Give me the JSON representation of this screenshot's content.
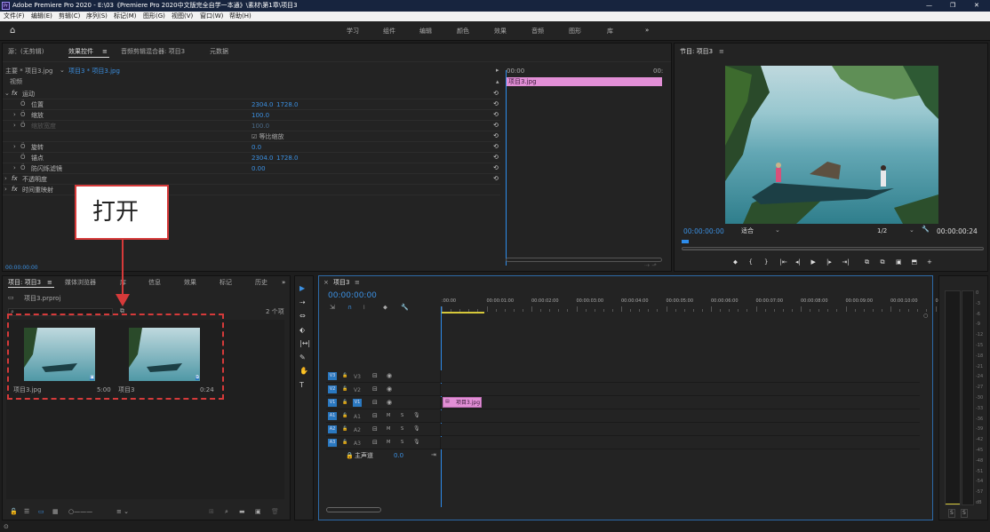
{
  "app": {
    "title": "Adobe Premiere Pro 2020 - E:\\03《Premiere Pro 2020中文版完全自学一本通》\\素材\\第1章\\项目3",
    "window_controls": [
      "—",
      "❐",
      "✕"
    ]
  },
  "menu": [
    "文件(F)",
    "编辑(E)",
    "剪辑(C)",
    "序列(S)",
    "标记(M)",
    "图形(G)",
    "视图(V)",
    "窗口(W)",
    "帮助(H)"
  ],
  "workspaces": [
    "学习",
    "组件",
    "编辑",
    "颜色",
    "效果",
    "音频",
    "图形",
    "库"
  ],
  "workspace_more": "»",
  "effects": {
    "tabs": [
      "源：(无剪辑)",
      "效果控件",
      "音频剪辑混合器: 项目3",
      "元数据"
    ],
    "menu_glyph": "≡",
    "master": "主要 * 项目3.jpg",
    "clip": "项目3 * 项目3.jpg",
    "section": "视频",
    "rows": [
      {
        "indent": 0,
        "exp": "⌄",
        "fx": "fx",
        "name": "运动",
        "v1": "",
        "v2": "",
        "reset": "⟲"
      },
      {
        "indent": 1,
        "exp": "",
        "fx": "Ö",
        "name": "位置",
        "v1": "2304.0",
        "v2": "1728.0",
        "reset": "⟲"
      },
      {
        "indent": 1,
        "exp": "›",
        "fx": "Ö",
        "name": "缩放",
        "v1": "100.0",
        "v2": "",
        "reset": "⟲"
      },
      {
        "indent": 1,
        "exp": "›",
        "fx": "Ö",
        "name": "缩放宽度",
        "v1": "100.0",
        "v2": "",
        "reset": "⟲",
        "dim": true
      },
      {
        "indent": 1,
        "exp": "",
        "fx": "",
        "name": "",
        "v1": "☑ 等比缩放",
        "v2": "",
        "reset": "⟲"
      },
      {
        "indent": 1,
        "exp": "›",
        "fx": "Ö",
        "name": "旋转",
        "v1": "0.0",
        "v2": "",
        "reset": "⟲"
      },
      {
        "indent": 1,
        "exp": "",
        "fx": "Ö",
        "name": "锚点",
        "v1": "2304.0",
        "v2": "1728.0",
        "reset": "⟲"
      },
      {
        "indent": 1,
        "exp": "›",
        "fx": "Ö",
        "name": "防闪烁滤镜",
        "v1": "0.00",
        "v2": "",
        "reset": "⟲"
      },
      {
        "indent": 0,
        "exp": "›",
        "fx": "fx",
        "name": "不透明度",
        "v1": "",
        "v2": "",
        "reset": "⟲"
      },
      {
        "indent": 0,
        "exp": "›",
        "fx": "fx",
        "name": "时间重映射",
        "v1": "",
        "v2": "",
        "reset": ""
      }
    ],
    "tl_time0": "00:00",
    "tl_time1": "00:",
    "tl_clip": "项目3.jpg",
    "timecode": "00:00:00:00"
  },
  "annotation": {
    "label": "打开"
  },
  "program": {
    "title": "节目: 项目3",
    "menu_glyph": "≡",
    "timecode": "00:00:00:00",
    "fit": "适合",
    "quality": "1/2",
    "duration": "00:00:00:24",
    "wrench": "🔧"
  },
  "transport": [
    "⬥",
    "{",
    "}",
    "|⇤",
    "◂|",
    "▶",
    "|▸",
    "⇥|",
    "⧉",
    "⧉",
    "▣",
    "⬒",
    "+"
  ],
  "project": {
    "tabs": [
      "项目: 项目3",
      "媒体浏览器",
      "库",
      "信息",
      "效果",
      "标记",
      "历史"
    ],
    "menu_glyph": "≡",
    "more": "»",
    "file": "项目3.prproj",
    "count": "2 个项",
    "search_icon": "⌕",
    "items": [
      {
        "name": "项目3.jpg",
        "dur": "5:00"
      },
      {
        "name": "项目3",
        "dur": "0:24"
      }
    ]
  },
  "tools": [
    "▶",
    "⇢",
    "⇔",
    "⬖",
    "|↔|",
    "✎",
    "✋",
    "T"
  ],
  "sequence": {
    "tab": "项目3",
    "menu_glyph": "≡",
    "close": "×",
    "timecode": "00:00:00:00",
    "ruler": [
      ":00:00",
      "00:00:01:00",
      "00:00:02:00",
      "00:00:03:00",
      "00:00:04:00",
      "00:00:05:00",
      "00:00:06:00",
      "00:00:07:00",
      "00:00:08:00",
      "00:00:09:00",
      "00:00:10:00",
      "00"
    ],
    "tracks": [
      {
        "a": "V3",
        "b": "V3",
        "c": "",
        "kind": "v"
      },
      {
        "a": "V2",
        "b": "V2",
        "c": "",
        "kind": "v"
      },
      {
        "a": "V1",
        "b": "V1",
        "c": "",
        "kind": "v",
        "target": true
      },
      {
        "a": "A1",
        "b": "A1",
        "c": "",
        "kind": "a"
      },
      {
        "a": "A2",
        "b": "A2",
        "c": "",
        "kind": "a"
      },
      {
        "a": "A3",
        "b": "A3",
        "c": "",
        "kind": "a"
      }
    ],
    "master": "主声道",
    "master_val": "0.0",
    "clip": "项目3.jpg",
    "m": "M",
    "s": "S"
  },
  "meter": {
    "labels": [
      "0",
      "-3",
      "-6",
      "-9",
      "-12",
      "-15",
      "-18",
      "-21",
      "-24",
      "-27",
      "-30",
      "-33",
      "-36",
      "-39",
      "-42",
      "-45",
      "-48",
      "-51",
      "-54",
      "-57",
      "dB"
    ],
    "solo": [
      "S",
      "S"
    ]
  },
  "colors": {
    "accent": "#2d8ceb",
    "clip": "#e28fd6",
    "annotation": "#d63a3a"
  }
}
